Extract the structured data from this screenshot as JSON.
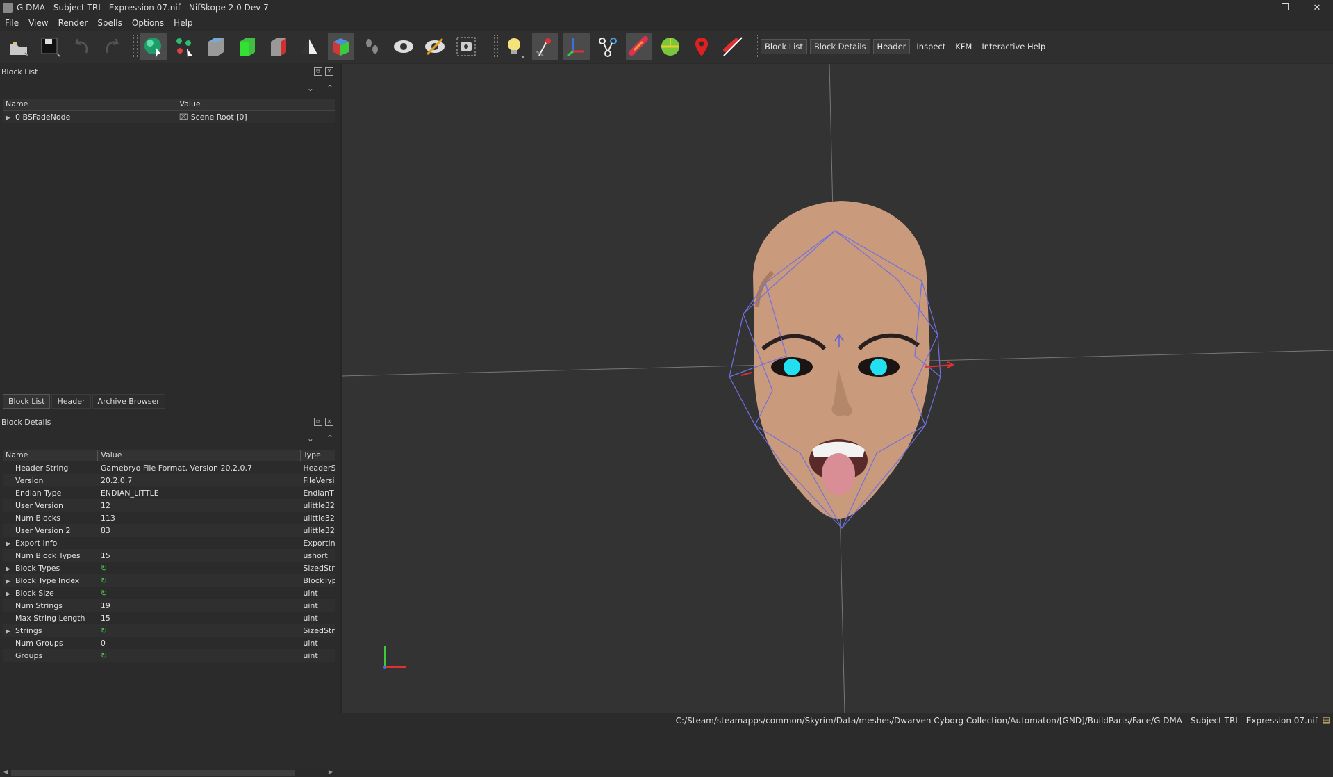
{
  "window": {
    "title": "G DMA - Subject TRI - Expression 07.nif - NifSkope 2.0 Dev 7",
    "controls": {
      "minimize": "–",
      "restore": "❐",
      "close": "✕"
    }
  },
  "menu": [
    "File",
    "View",
    "Render",
    "Spells",
    "Options",
    "Help"
  ],
  "toolbar": {
    "text_buttons": [
      "Block List",
      "Block Details",
      "Header",
      "Inspect",
      "KFM",
      "Interactive Help"
    ],
    "icons": [
      "load-icon",
      "save-icon",
      "undo-icon",
      "redo-icon",
      "select-object-icon",
      "select-vertex-icon",
      "view-top-icon",
      "view-front-icon",
      "view-side-icon",
      "view-user-icon",
      "view-walk-icon",
      "show-hidden-icon",
      "show-nodes-icon",
      "show-constraints-icon",
      "screenshot-icon",
      "lighting-icon",
      "show-axes-icon",
      "show-grid-icon",
      "show-skeleton-icon",
      "show-bounds-icon",
      "textures-icon",
      "vertex-colors-icon",
      "show-markers-icon",
      "disable-shaders-icon"
    ]
  },
  "block_list": {
    "title": "Block List",
    "columns": [
      "Name",
      "Value"
    ],
    "rows": [
      {
        "name": "0 BSFadeNode",
        "value": "Scene Root [0]"
      }
    ]
  },
  "tabs": [
    "Block List",
    "Header",
    "Archive Browser"
  ],
  "block_details": {
    "title": "Block Details",
    "columns": [
      "Name",
      "Value",
      "Type"
    ],
    "rows": [
      {
        "expand": false,
        "name": "Header String",
        "value": "Gamebryo File Format, Version 20.2.0.7",
        "type": "HeaderS"
      },
      {
        "expand": false,
        "name": "Version",
        "value": "20.2.0.7",
        "type": "FileVersi"
      },
      {
        "expand": false,
        "name": "Endian Type",
        "value": "ENDIAN_LITTLE",
        "type": "EndianT"
      },
      {
        "expand": false,
        "name": "User Version",
        "value": "12",
        "type": "ulittle32"
      },
      {
        "expand": false,
        "name": "Num Blocks",
        "value": "113",
        "type": "ulittle32"
      },
      {
        "expand": false,
        "name": "User Version 2",
        "value": "83",
        "type": "ulittle32"
      },
      {
        "expand": true,
        "name": "Export Info",
        "value": "",
        "type": "ExportIn"
      },
      {
        "expand": false,
        "name": "Num Block Types",
        "value": "15",
        "type": "ushort"
      },
      {
        "expand": true,
        "name": "Block Types",
        "value": "↻",
        "type": "SizedStri"
      },
      {
        "expand": true,
        "name": "Block Type Index",
        "value": "↻",
        "type": "BlockTyp"
      },
      {
        "expand": true,
        "name": "Block Size",
        "value": "↻",
        "type": "uint"
      },
      {
        "expand": false,
        "name": "Num Strings",
        "value": "19",
        "type": "uint"
      },
      {
        "expand": false,
        "name": "Max String Length",
        "value": "15",
        "type": "uint"
      },
      {
        "expand": true,
        "name": "Strings",
        "value": "↻",
        "type": "SizedStri"
      },
      {
        "expand": false,
        "name": "Num Groups",
        "value": "0",
        "type": "uint"
      },
      {
        "expand": false,
        "name": "Groups",
        "value": "↻",
        "type": "uint"
      }
    ]
  },
  "status": {
    "path": "C:/Steam/steamapps/common/Skyrim/Data/meshes/Dwarven Cyborg Collection/Automaton/[GND]/BuildParts/Face/G DMA - Subject TRI - Expression 07.nif"
  },
  "colors": {
    "accent_green": "#4fc14f",
    "wire": "#7070e0",
    "eye": "#22e0f0"
  }
}
